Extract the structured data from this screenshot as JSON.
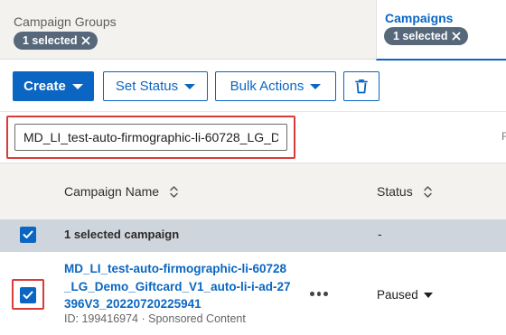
{
  "tabs": {
    "groups": {
      "title": "Campaign Groups",
      "chip": "1 selected"
    },
    "campaigns": {
      "title": "Campaigns",
      "chip": "1 selected"
    }
  },
  "toolbar": {
    "create_label": "Create",
    "set_status_label": "Set Status",
    "bulk_actions_label": "Bulk Actions"
  },
  "search": {
    "value": "MD_LI_test-auto-firmographic-li-60728_LG_D",
    "trailing_char": "F"
  },
  "table": {
    "columns": [
      "Campaign Name",
      "Status"
    ],
    "selection_summary": {
      "label": "1 selected campaign",
      "status": "-"
    },
    "rows": [
      {
        "name_lines": [
          "MD_LI_test-auto-firmographic-li-60728",
          "_LG_Demo_Giftcard_V1_auto-li-i-ad-27",
          "396V3_20220720225941"
        ],
        "meta": "ID: 199416974 · Sponsored Content",
        "status": "Paused"
      }
    ]
  },
  "colors": {
    "accent": "#0a66c2",
    "chip": "#56687a",
    "highlight": "#d93b3b"
  }
}
